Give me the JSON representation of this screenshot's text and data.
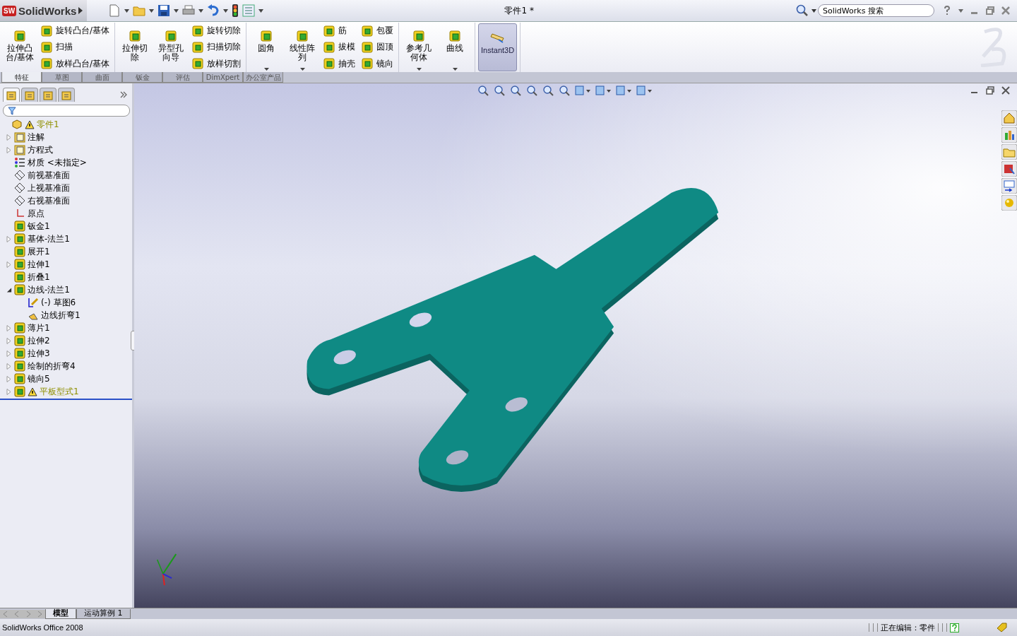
{
  "app": {
    "logo_mark": "SW",
    "logo_text": "SolidWorks"
  },
  "window": {
    "title": "零件1 *"
  },
  "search": {
    "placeholder": "SolidWorks 搜索"
  },
  "ribbon": {
    "groups": [
      {
        "columns": [
          {
            "kind": "large",
            "label": "拉伸凸台/基体",
            "has_menu": false
          },
          {
            "kind": "stack",
            "items": [
              "旋转凸台/基体",
              "扫描",
              "放样凸台/基体"
            ]
          }
        ]
      },
      {
        "columns": [
          {
            "kind": "large",
            "label": "拉伸切除",
            "has_menu": false
          },
          {
            "kind": "large",
            "label": "异型孔向导",
            "has_menu": false
          },
          {
            "kind": "stack",
            "items": [
              "旋转切除",
              "扫描切除",
              "放样切割"
            ]
          }
        ]
      },
      {
        "columns": [
          {
            "kind": "large",
            "label": "圆角",
            "has_menu": true
          },
          {
            "kind": "large",
            "label": "线性阵列",
            "has_menu": true
          },
          {
            "kind": "stack",
            "items": [
              "筋",
              "拔模",
              "抽壳"
            ]
          },
          {
            "kind": "stack",
            "items": [
              "包覆",
              "圆顶",
              "镜向"
            ]
          }
        ]
      },
      {
        "columns": [
          {
            "kind": "large",
            "label": "参考几何体",
            "has_menu": true
          },
          {
            "kind": "large",
            "label": "曲线",
            "has_menu": true
          }
        ]
      },
      {
        "columns": [
          {
            "kind": "toggle",
            "label": "Instant3D",
            "selected": true
          }
        ]
      }
    ]
  },
  "ribbon_tabs": [
    {
      "label": "特征",
      "selected": true
    },
    {
      "label": "草图",
      "selected": false
    },
    {
      "label": "曲面",
      "selected": false
    },
    {
      "label": "钣金",
      "selected": false
    },
    {
      "label": "评估",
      "selected": false
    },
    {
      "label": "DimXpert",
      "selected": false
    },
    {
      "label": "办公室产品",
      "selected": false
    }
  ],
  "manager_tabs": [
    {
      "selected": true
    },
    {
      "selected": false
    },
    {
      "selected": false
    },
    {
      "selected": false
    }
  ],
  "tree": {
    "root": {
      "label": "零件1",
      "warning": true
    },
    "items": [
      {
        "label": "注解",
        "kind": "folder",
        "expandable": true,
        "expanded": false,
        "warning": false
      },
      {
        "label": "方程式",
        "kind": "folder",
        "expandable": true,
        "expanded": false,
        "warning": false
      },
      {
        "label": "材质 <未指定>",
        "kind": "material",
        "expandable": false,
        "warning": false
      },
      {
        "label": "前视基准面",
        "kind": "plane",
        "expandable": false,
        "warning": false
      },
      {
        "label": "上视基准面",
        "kind": "plane",
        "expandable": false,
        "warning": false
      },
      {
        "label": "右视基准面",
        "kind": "plane",
        "expandable": false,
        "warning": false
      },
      {
        "label": "原点",
        "kind": "origin",
        "expandable": false,
        "warning": false
      },
      {
        "label": "钣金1",
        "kind": "feature",
        "expandable": false,
        "warning": false
      },
      {
        "label": "基体-法兰1",
        "kind": "feature",
        "expandable": true,
        "expanded": false,
        "warning": false
      },
      {
        "label": "展开1",
        "kind": "feature",
        "expandable": false,
        "warning": false
      },
      {
        "label": "拉伸1",
        "kind": "feature",
        "expandable": true,
        "expanded": false,
        "warning": false
      },
      {
        "label": "折叠1",
        "kind": "feature",
        "expandable": false,
        "warning": false
      },
      {
        "label": "边线-法兰1",
        "kind": "feature",
        "expandable": true,
        "expanded": true,
        "warning": false,
        "children": [
          {
            "label": "(-) 草图6",
            "kind": "sketch",
            "warning": false
          },
          {
            "label": "边线折弯1",
            "kind": "feature",
            "warning": false
          }
        ]
      },
      {
        "label": "薄片1",
        "kind": "feature",
        "expandable": true,
        "expanded": false,
        "warning": false
      },
      {
        "label": "拉伸2",
        "kind": "feature",
        "expandable": true,
        "expanded": false,
        "warning": false
      },
      {
        "label": "拉伸3",
        "kind": "feature",
        "expandable": true,
        "expanded": false,
        "warning": false
      },
      {
        "label": "绘制的折弯4",
        "kind": "feature",
        "expandable": true,
        "expanded": false,
        "warning": false
      },
      {
        "label": "镜向5",
        "kind": "feature",
        "expandable": true,
        "expanded": false,
        "warning": false
      },
      {
        "label": "平板型式1",
        "kind": "feature",
        "expandable": true,
        "expanded": false,
        "warning": true
      }
    ]
  },
  "bottom_tabs": [
    {
      "label": "模型",
      "selected": true
    },
    {
      "label": "运动算例 1",
      "selected": false
    }
  ],
  "status_bar": {
    "product": "SolidWorks Office 2008",
    "editing": "正在编辑：零件"
  }
}
